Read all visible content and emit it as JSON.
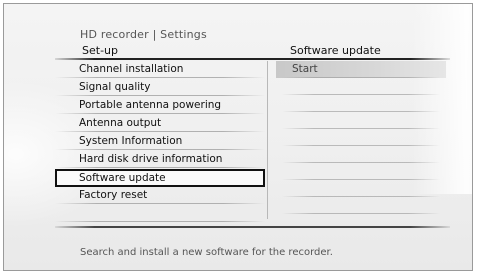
{
  "header": {
    "title": "HD recorder | Settings",
    "left_column": "Set-up",
    "right_column": "Software update"
  },
  "menu": {
    "items": [
      {
        "label": "Channel installation",
        "selected": false
      },
      {
        "label": "Signal quality",
        "selected": false
      },
      {
        "label": "Portable antenna powering",
        "selected": false
      },
      {
        "label": "Antenna output",
        "selected": false
      },
      {
        "label": "System Information",
        "selected": false
      },
      {
        "label": "Hard disk drive information",
        "selected": false
      },
      {
        "label": "Software update",
        "selected": true
      },
      {
        "label": "Factory reset",
        "selected": false
      }
    ]
  },
  "submenu": {
    "items": [
      {
        "label": "Start"
      }
    ]
  },
  "help": {
    "text": "Search and install a new software for the recorder."
  }
}
